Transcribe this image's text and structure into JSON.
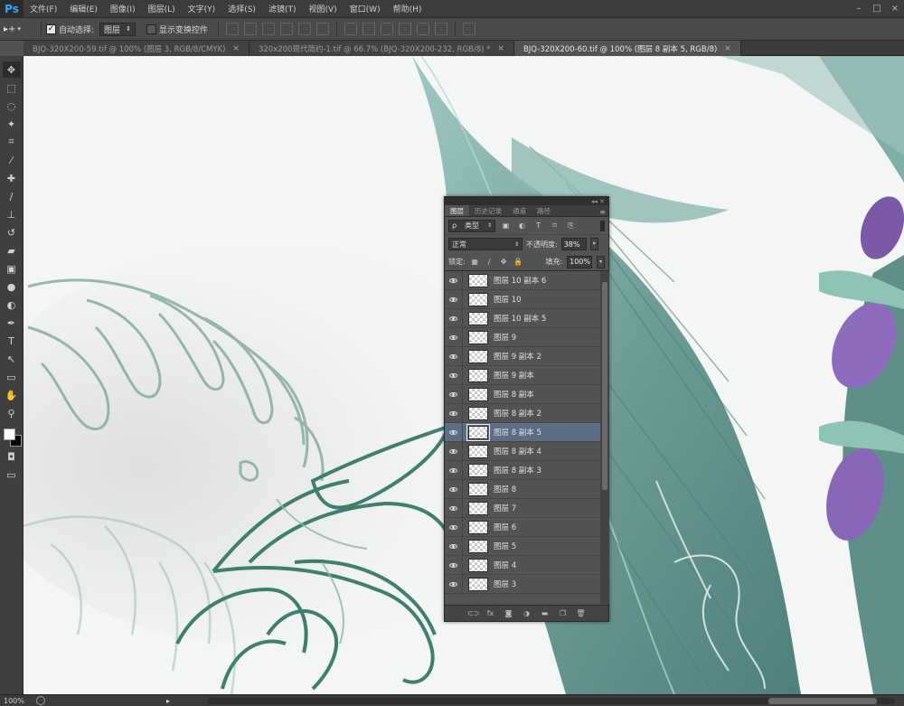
{
  "app": {
    "logo": "Ps"
  },
  "menu": [
    "文件(F)",
    "编辑(E)",
    "图像(I)",
    "图层(L)",
    "文字(Y)",
    "选择(S)",
    "滤镜(T)",
    "视图(V)",
    "窗口(W)",
    "帮助(H)"
  ],
  "window_controls": [
    "–",
    "□",
    "×"
  ],
  "options": {
    "auto_select_label": "自动选择:",
    "auto_select_checked": true,
    "auto_select_target": "图层",
    "show_transform_label": "显示变换控件",
    "show_transform_checked": false
  },
  "tabs": [
    {
      "label": "BJQ-320X200-59.tif @ 100% (图层 3, RGB/8/CMYK)",
      "active": false
    },
    {
      "label": "320x200现代简约-1.tif @ 66.7% (BJQ-320X200-232, RGB/8) *",
      "active": false
    },
    {
      "label": "BJQ-320X200-60.tif @ 100% (图层 8 副本 5, RGB/8)",
      "active": true
    }
  ],
  "tools": [
    "move-tool-icon",
    "marquee-tool-icon",
    "lasso-tool-icon",
    "magic-wand-icon",
    "crop-tool-icon",
    "eyedropper-icon",
    "healing-brush-icon",
    "brush-tool-icon",
    "clone-stamp-icon",
    "history-brush-icon",
    "eraser-icon",
    "gradient-tool-icon",
    "blur-tool-icon",
    "dodge-tool-icon",
    "pen-tool-icon",
    "type-tool-icon",
    "path-select-icon",
    "rectangle-tool-icon",
    "hand-tool-icon",
    "zoom-tool-icon"
  ],
  "tool_glyphs": {
    "move-tool-icon": "✥",
    "marquee-tool-icon": "⬚",
    "lasso-tool-icon": "◌",
    "magic-wand-icon": "✦",
    "crop-tool-icon": "⌗",
    "eyedropper-icon": "⁄",
    "healing-brush-icon": "✚",
    "brush-tool-icon": "∕",
    "clone-stamp-icon": "⊥",
    "history-brush-icon": "↺",
    "eraser-icon": "▰",
    "gradient-tool-icon": "▣",
    "blur-tool-icon": "●",
    "dodge-tool-icon": "◐",
    "pen-tool-icon": "✒",
    "type-tool-icon": "T",
    "path-select-icon": "↖",
    "rectangle-tool-icon": "▭",
    "hand-tool-icon": "✋",
    "zoom-tool-icon": "⚲"
  },
  "layers_panel": {
    "tabs": [
      "图层",
      "历史记录",
      "通道",
      "路径"
    ],
    "filter_kind": "类型",
    "blend_mode": "正常",
    "opacity_label": "不透明度:",
    "opacity": "38%",
    "lock_label": "锁定:",
    "fill_label": "填充:",
    "fill": "100%",
    "layers": [
      {
        "name": "图层 10 副本 6",
        "selected": false
      },
      {
        "name": "图层 10",
        "selected": false
      },
      {
        "name": "图层 10 副本 5",
        "selected": false
      },
      {
        "name": "图层 9",
        "selected": false
      },
      {
        "name": "图层 9 副本 2",
        "selected": false
      },
      {
        "name": "图层 9 副本",
        "selected": false
      },
      {
        "name": "图层 8 副本",
        "selected": false
      },
      {
        "name": "图层 8 副本 2",
        "selected": false
      },
      {
        "name": "图层 8 副本 5",
        "selected": true
      },
      {
        "name": "图层 8 副本 4",
        "selected": false
      },
      {
        "name": "图层 8 副本 3",
        "selected": false
      },
      {
        "name": "图层 8",
        "selected": false
      },
      {
        "name": "图层 7",
        "selected": false
      },
      {
        "name": "图层 6",
        "selected": false
      },
      {
        "name": "图层 5",
        "selected": false
      },
      {
        "name": "图层 4",
        "selected": false
      },
      {
        "name": "图层 3",
        "selected": false
      }
    ],
    "footer_buttons": [
      "link-layers-icon",
      "fx-icon",
      "add-mask-icon",
      "adjustment-layer-icon",
      "new-group-icon",
      "new-layer-icon",
      "delete-layer-icon"
    ],
    "footer_glyphs": {
      "link-layers-icon": "⊂⊃",
      "fx-icon": "fx",
      "add-mask-icon": "◙",
      "adjustment-layer-icon": "◑",
      "new-group-icon": "▬",
      "new-layer-icon": "❐",
      "delete-layer-icon": "🗑"
    }
  },
  "status": {
    "zoom": "100%"
  }
}
